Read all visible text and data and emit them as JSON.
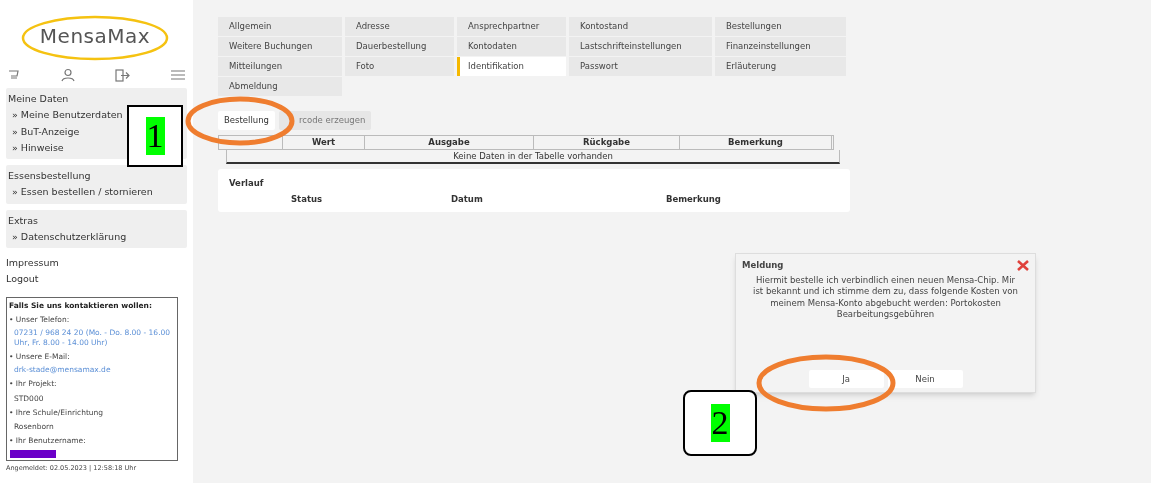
{
  "logo": {
    "text": "MensaMax"
  },
  "sidebar": {
    "sections": [
      {
        "title": "Meine Daten",
        "items": [
          "» Meine Benutzerdaten",
          "» BuT-Anzeige",
          "» Hinweise"
        ]
      },
      {
        "title": "Essensbestellung",
        "items": [
          "» Essen bestellen / stornieren"
        ]
      },
      {
        "title": "Extras",
        "items": [
          "» Datenschutzerklärung"
        ]
      }
    ],
    "links": [
      "Impressum",
      "Logout"
    ],
    "contact": {
      "title": "Falls Sie uns kontaktieren wollen:",
      "entries": [
        {
          "label": "• Unser Telefon:",
          "value": "07231 / 968 24 20 (Mo. - Do. 8.00 - 16.00 Uhr, Fr. 8.00 - 14.00 Uhr)",
          "kind": "link"
        },
        {
          "label": "• Unsere E-Mail:",
          "value": "drk-stade@mensamax.de",
          "kind": "link"
        },
        {
          "label": "• Ihr Projekt:",
          "value": "STD000",
          "kind": "text"
        },
        {
          "label": "• Ihre Schule/Einrichtung",
          "value": "Rosenborn",
          "kind": "text"
        },
        {
          "label": "• Ihr Benutzername:",
          "kind": "redacted"
        }
      ]
    },
    "login_info": "Angemeldet: 02.05.2023 | 12:58:18 Uhr"
  },
  "tabs": [
    {
      "label": "Allgemein",
      "selected": false
    },
    {
      "label": "Adresse",
      "selected": false
    },
    {
      "label": "Ansprechpartner",
      "selected": false
    },
    {
      "label": "Kontostand",
      "selected": false
    },
    {
      "label": "Bestellungen",
      "selected": false
    },
    {
      "label": "Weitere Buchungen",
      "selected": false
    },
    {
      "label": "Dauerbestellung",
      "selected": false
    },
    {
      "label": "Kontodaten",
      "selected": false
    },
    {
      "label": "Lastschrifteinstellungen",
      "selected": false
    },
    {
      "label": "Finanzeinstellungen",
      "selected": false
    },
    {
      "label": "Mitteilungen",
      "selected": false
    },
    {
      "label": "Foto",
      "selected": false
    },
    {
      "label": "Identifikation",
      "selected": true
    },
    {
      "label": "Passwort",
      "selected": false
    },
    {
      "label": "Erläuterung",
      "selected": false
    },
    {
      "label": "Abmeldung",
      "selected": false
    }
  ],
  "subtabs": [
    {
      "label": "Bestellung",
      "selected": true
    },
    {
      "label": "rcode erzeugen",
      "selected": false
    }
  ],
  "table": {
    "columns": [
      "",
      "Wert",
      "Ausgabe",
      "Rückgabe",
      "Bemerkung"
    ],
    "empty_text": "Keine Daten in der Tabelle vorhanden"
  },
  "history": {
    "title": "Verlauf",
    "columns": [
      "Status",
      "Datum",
      "Bemerkung"
    ]
  },
  "dialog": {
    "title": "Meldung",
    "message": "Hiermit bestelle ich verbindlich einen neuen Mensa-Chip. Mir ist bekannt und ich stimme dem zu, dass folgende Kosten von meinem Mensa-Konto abgebucht werden: Portokosten Bearbeitungsgebühren",
    "buttons": [
      "Ja",
      "Nein"
    ]
  },
  "annotations": [
    "1",
    "2"
  ]
}
